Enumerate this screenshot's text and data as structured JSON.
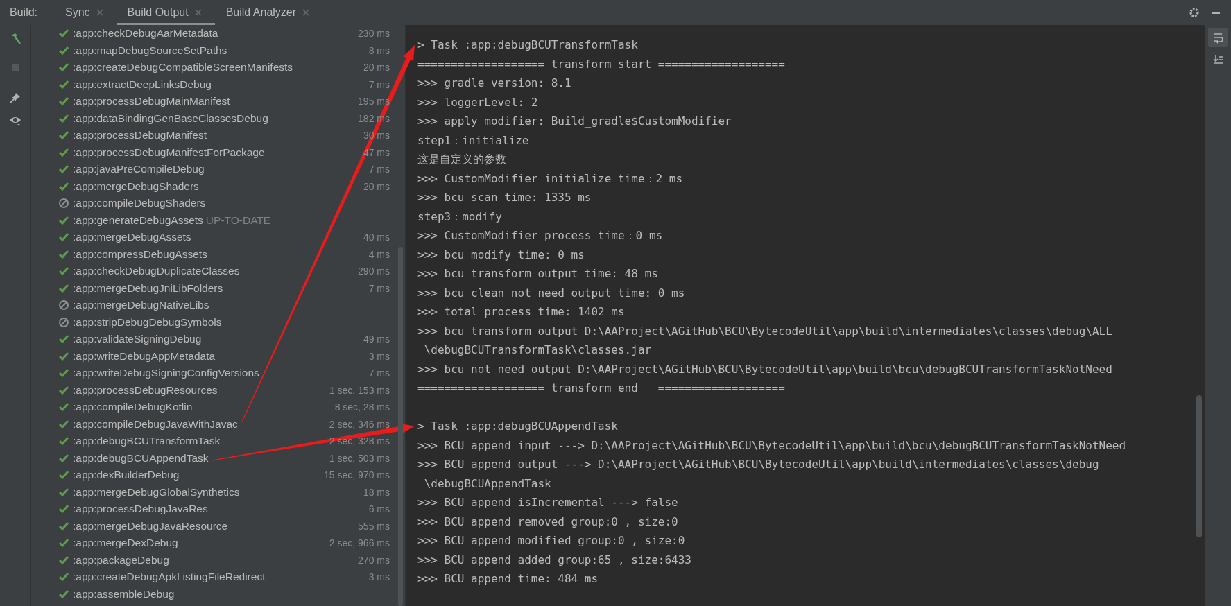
{
  "panel_title": "Build:",
  "tabs": [
    {
      "label": "Sync",
      "selected": false
    },
    {
      "label": "Build Output",
      "selected": true
    },
    {
      "label": "Build Analyzer",
      "selected": false
    }
  ],
  "side_tools": [
    {
      "kind": "hammer",
      "disabled": false
    },
    {
      "kind": "stop",
      "disabled": true
    },
    {
      "kind": "pin",
      "disabled": false
    },
    {
      "kind": "eye",
      "disabled": false
    }
  ],
  "tasks": [
    {
      "name": ":app:checkDebugAarMetadata",
      "kind": "success",
      "duration": "230 ms"
    },
    {
      "name": ":app:mapDebugSourceSetPaths",
      "kind": "success",
      "duration": "8 ms"
    },
    {
      "name": ":app:createDebugCompatibleScreenManifests",
      "kind": "success",
      "duration": "20 ms"
    },
    {
      "name": ":app:extractDeepLinksDebug",
      "kind": "success",
      "duration": "7 ms"
    },
    {
      "name": ":app:processDebugMainManifest",
      "kind": "success",
      "duration": "195 ms"
    },
    {
      "name": ":app:dataBindingGenBaseClassesDebug",
      "kind": "success",
      "duration": "182 ms"
    },
    {
      "name": ":app:processDebugManifest",
      "kind": "success",
      "duration": "30 ms"
    },
    {
      "name": ":app:processDebugManifestForPackage",
      "kind": "success",
      "duration": "47 ms"
    },
    {
      "name": ":app:javaPreCompileDebug",
      "kind": "success",
      "duration": "7 ms"
    },
    {
      "name": ":app:mergeDebugShaders",
      "kind": "success",
      "duration": "20 ms"
    },
    {
      "name": ":app:compileDebugShaders",
      "kind": "skipped"
    },
    {
      "name": ":app:generateDebugAssets",
      "kind": "success",
      "note": "UP-TO-DATE"
    },
    {
      "name": ":app:mergeDebugAssets",
      "kind": "success",
      "duration": "40 ms"
    },
    {
      "name": ":app:compressDebugAssets",
      "kind": "success",
      "duration": "4 ms"
    },
    {
      "name": ":app:checkDebugDuplicateClasses",
      "kind": "success",
      "duration": "290 ms"
    },
    {
      "name": ":app:mergeDebugJniLibFolders",
      "kind": "success",
      "duration": "7 ms"
    },
    {
      "name": ":app:mergeDebugNativeLibs",
      "kind": "skipped"
    },
    {
      "name": ":app:stripDebugDebugSymbols",
      "kind": "skipped"
    },
    {
      "name": ":app:validateSigningDebug",
      "kind": "success",
      "duration": "49 ms"
    },
    {
      "name": ":app:writeDebugAppMetadata",
      "kind": "success",
      "duration": "3 ms"
    },
    {
      "name": ":app:writeDebugSigningConfigVersions",
      "kind": "success",
      "duration": "7 ms"
    },
    {
      "name": ":app:processDebugResources",
      "kind": "success",
      "duration": "1 sec, 153 ms"
    },
    {
      "name": ":app:compileDebugKotlin",
      "kind": "success",
      "duration": "8 sec, 28 ms"
    },
    {
      "name": ":app:compileDebugJavaWithJavac",
      "kind": "success",
      "duration": "2 sec, 346 ms",
      "arrow_from": true
    },
    {
      "name": ":app:debugBCUTransformTask",
      "kind": "success",
      "duration": "2 sec, 328 ms"
    },
    {
      "name": ":app:debugBCUAppendTask",
      "kind": "success",
      "duration": "1 sec, 503 ms",
      "arrow_from": true
    },
    {
      "name": ":app:dexBuilderDebug",
      "kind": "success",
      "duration": "15 sec, 970 ms"
    },
    {
      "name": ":app:mergeDebugGlobalSynthetics",
      "kind": "success",
      "duration": "18 ms"
    },
    {
      "name": ":app:processDebugJavaRes",
      "kind": "success",
      "duration": "6 ms"
    },
    {
      "name": ":app:mergeDebugJavaResource",
      "kind": "success",
      "duration": "555 ms"
    },
    {
      "name": ":app:mergeDexDebug",
      "kind": "success",
      "duration": "2 sec, 966 ms"
    },
    {
      "name": ":app:packageDebug",
      "kind": "success",
      "duration": "270 ms"
    },
    {
      "name": ":app:createDebugApkListingFileRedirect",
      "kind": "success",
      "duration": "3 ms"
    },
    {
      "name": ":app:assembleDebug",
      "kind": "success"
    }
  ],
  "console_blocks": [
    {
      "arrow_to": true,
      "lines": [
        "> Task :app:debugBCUTransformTask",
        "=================== transform start ===================",
        ">>> gradle version: 8.1",
        ">>> loggerLevel: 2",
        ">>> apply modifier: Build_gradle$CustomModifier",
        "step1：initialize",
        "这是自定义的参数",
        ">>> CustomModifier initialize time：2 ms",
        ">>> bcu scan time: 1335 ms",
        "step3：modify",
        ">>> CustomModifier process time：0 ms",
        ">>> bcu modify time: 0 ms",
        ">>> bcu transform output time: 48 ms",
        ">>> bcu clean not need output time: 0 ms",
        ">>> total process time: 1402 ms",
        ">>> bcu transform output D:\\AAProject\\AGitHub\\BCU\\BytecodeUtil\\app\\build\\intermediates\\classes\\debug\\ALL",
        " \\debugBCUTransformTask\\classes.jar",
        ">>> bcu not need output D:\\AAProject\\AGitHub\\BCU\\BytecodeUtil\\app\\build\\bcu\\debugBCUTransformTaskNotNeed",
        "=================== transform end   ==================="
      ]
    },
    {
      "arrow_to": true,
      "lines": [
        "> Task :app:debugBCUAppendTask",
        ">>> BCU append input ---> D:\\AAProject\\AGitHub\\BCU\\BytecodeUtil\\app\\build\\bcu\\debugBCUTransformTaskNotNeed",
        ">>> BCU append output ---> D:\\AAProject\\AGitHub\\BCU\\BytecodeUtil\\app\\build\\intermediates\\classes\\debug",
        " \\debugBCUAppendTask",
        ">>> BCU append isIncremental ---> false",
        ">>> BCU append removed group:0 , size:0",
        ">>> BCU append modified group:0 , size:0",
        ">>> BCU append added group:65 , size:6433",
        ">>> BCU append time: 484 ms"
      ]
    }
  ],
  "console_tools": [
    {
      "kind": "soft_wrap",
      "selected": true
    },
    {
      "kind": "scroll_to_end",
      "selected": false
    }
  ]
}
